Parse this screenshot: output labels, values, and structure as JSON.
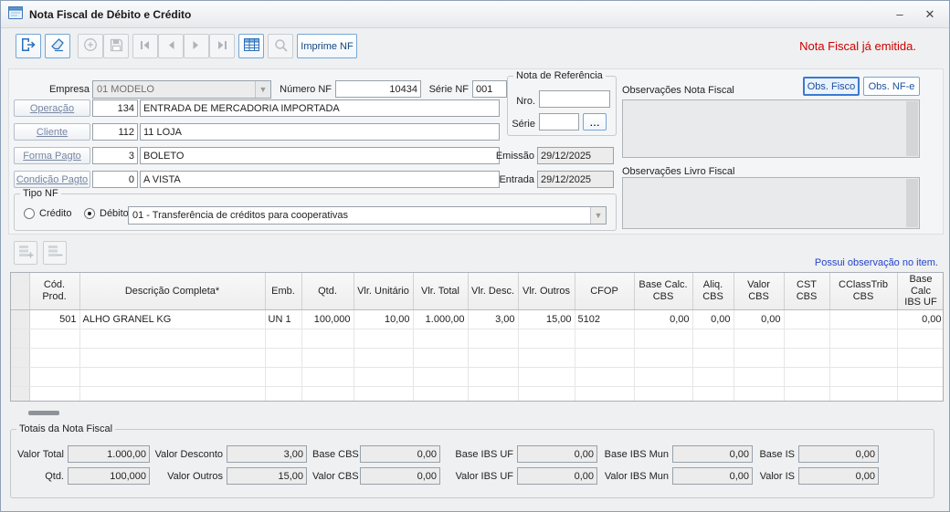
{
  "window": {
    "title": "Nota Fiscal de Débito e Crédito"
  },
  "icons": {
    "minimize": "–",
    "close": "✕",
    "dropdown_arrow": "▼",
    "ellipsis": "..."
  },
  "toolbar": {
    "imprime_nf": "Imprime NF",
    "status": "Nota Fiscal já emitida."
  },
  "header": {
    "empresa_label": "Empresa",
    "empresa_value": "01 MODELO",
    "numero_nf_label": "Número NF",
    "numero_nf_value": "10434",
    "serie_nf_label": "Série NF",
    "serie_nf_value": "001",
    "nota_ref": {
      "title": "Nota de Referência",
      "nro_label": "Nro.",
      "nro_value": "",
      "serie_label": "Série",
      "serie_value": ""
    },
    "operacao_label": "Operação",
    "operacao_code": "134",
    "operacao_desc": "ENTRADA DE MERCADORIA IMPORTADA",
    "cliente_label": "Cliente",
    "cliente_code": "112",
    "cliente_desc": "11 LOJA",
    "forma_pagto_label": "Forma Pagto",
    "forma_pagto_code": "3",
    "forma_pagto_desc": "BOLETO",
    "condicao_pagto_label": "Condição Pagto",
    "condicao_pagto_code": "0",
    "condicao_pagto_desc": "A VISTA",
    "emissao_label": "Emissão",
    "emissao_value": "29/12/2025",
    "entrada_label": "Entrada",
    "entrada_value": "29/12/2025",
    "tipo_nf": {
      "title": "Tipo NF",
      "credito_label": "Crédito",
      "debito_label": "Débito",
      "tipo_value": "01 - Transferência de créditos para cooperativas"
    },
    "obs_nf_label": "Observações Nota Fiscal",
    "obs_fisco_btn": "Obs. Fisco",
    "obs_nfe_btn": "Obs. NF-e",
    "obs_livro_label": "Observações Livro Fiscal"
  },
  "items": {
    "note": "Possui observação no item.",
    "empty_row_count": 4,
    "headers": [
      "Cód.\nProd.",
      "Descrição Completa*",
      "Emb.",
      "Qtd.",
      "Vlr. Unitário",
      "Vlr. Total",
      "Vlr. Desc.",
      "Vlr. Outros",
      "CFOP",
      "Base Calc.\nCBS",
      "Aliq.\nCBS",
      "Valor\nCBS",
      "CST\nCBS",
      "CClassTrib\nCBS",
      "Base Calc\nIBS UF"
    ],
    "rows": [
      {
        "cells": [
          "501",
          "ALHO GRANEL KG",
          "UN  1",
          "100,000",
          "10,00",
          "1.000,00",
          "3,00",
          "15,00",
          "5102",
          "0,00",
          "0,00",
          "0,00",
          "",
          "",
          "0,00"
        ]
      }
    ]
  },
  "totals": {
    "title": "Totais da Nota Fiscal",
    "row1": [
      {
        "label": "Valor Total",
        "value": "1.000,00"
      },
      {
        "label": "Valor Desconto",
        "value": "3,00"
      },
      {
        "label": "Base CBS",
        "value": "0,00"
      },
      {
        "label": "Base IBS UF",
        "value": "0,00"
      },
      {
        "label": "Base IBS Mun",
        "value": "0,00"
      },
      {
        "label": "Base IS",
        "value": "0,00"
      }
    ],
    "row2": [
      {
        "label": "Qtd.",
        "value": "100,000"
      },
      {
        "label": "Valor Outros",
        "value": "15,00"
      },
      {
        "label": "Valor CBS",
        "value": "0,00"
      },
      {
        "label": "Valor IBS UF",
        "value": "0,00"
      },
      {
        "label": "Valor IBS Mun",
        "value": "0,00"
      },
      {
        "label": "Valor IS",
        "value": "0,00"
      }
    ]
  }
}
